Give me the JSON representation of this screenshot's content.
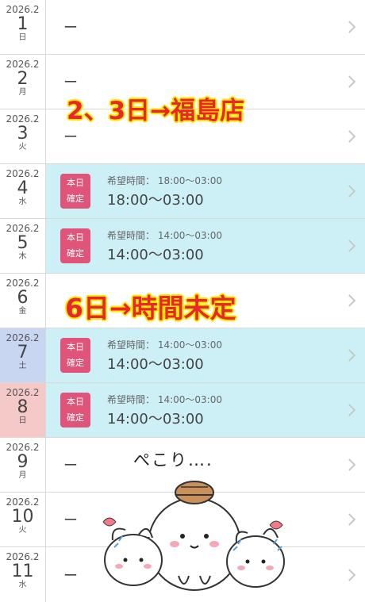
{
  "rows": [
    {
      "ym": "2026.2",
      "day": "1",
      "weekday": "日",
      "dash": "ー"
    },
    {
      "ym": "2026.2",
      "day": "2",
      "weekday": "月",
      "dash": "ー"
    },
    {
      "ym": "2026.2",
      "day": "3",
      "weekday": "火",
      "dash": "ー"
    },
    {
      "ym": "2026.2",
      "day": "4",
      "weekday": "水",
      "badge_top": "本日",
      "badge_bottom": "確定",
      "hope": "希望時間： 18:00〜03:00",
      "time": "18:00〜03:00"
    },
    {
      "ym": "2026.2",
      "day": "5",
      "weekday": "木",
      "badge_top": "本日",
      "badge_bottom": "確定",
      "hope": "希望時間： 14:00〜03:00",
      "time": "14:00〜03:00"
    },
    {
      "ym": "2026.2",
      "day": "6",
      "weekday": "金"
    },
    {
      "ym": "2026.2",
      "day": "7",
      "weekday": "土",
      "badge_top": "本日",
      "badge_bottom": "確定",
      "hope": "希望時間： 14:00〜03:00",
      "time": "14:00〜03:00"
    },
    {
      "ym": "2026.2",
      "day": "8",
      "weekday": "日",
      "badge_top": "本日",
      "badge_bottom": "確定",
      "hope": "希望時間： 14:00〜03:00",
      "time": "14:00〜03:00"
    },
    {
      "ym": "2026.2",
      "day": "9",
      "weekday": "月",
      "dash": "ー"
    },
    {
      "ym": "2026.2",
      "day": "10",
      "weekday": "火",
      "dash": "ー"
    },
    {
      "ym": "2026.2",
      "day": "11",
      "weekday": "水",
      "dash": "ー"
    }
  ],
  "overlay": {
    "note1": "2、3日→福島店",
    "note2": "6日→時間未定"
  },
  "sticker": {
    "caption": "ぺこり…."
  },
  "colors": {
    "shift_bg": "#cdf0f7",
    "badge": "#e0547a",
    "saturday": "#c9d6f2",
    "sunday": "#f6c9c9",
    "overlay_red": "#e8262b",
    "overlay_yellow": "#ffe800"
  }
}
